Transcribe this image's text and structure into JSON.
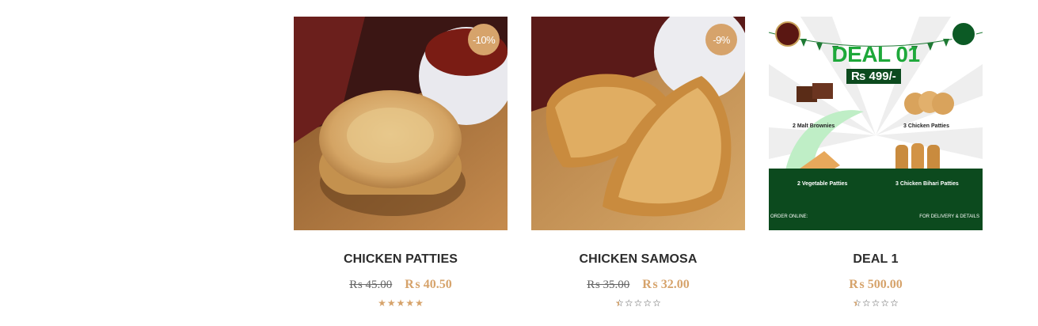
{
  "products": [
    {
      "title": "CHICKEN PATTIES",
      "badge": "-10%",
      "old_price": "₨ 45.00",
      "new_price": "₨ 40.50",
      "rating": 5
    },
    {
      "title": "CHICKEN SAMOSA",
      "badge": "-9%",
      "old_price": "₨ 35.00",
      "new_price": "₨ 32.00",
      "rating": 0.5
    },
    {
      "title": "DEAL 1",
      "badge": "",
      "old_price": "",
      "new_price": "₨ 500.00",
      "rating": 0.5,
      "banner": {
        "heading": "DEAL 01",
        "price": "₨ 499/-",
        "items": [
          "2 Malt Brownies",
          "3 Chicken Patties",
          "2 Vegetable Patties",
          "3 Chicken Bihari Patties"
        ],
        "order_online": "ORDER ONLINE:",
        "delivery": "FOR DELIVERY & DETAILS"
      }
    }
  ],
  "colors": {
    "accent": "#d6a36b",
    "title": "#2c2c2c",
    "deal_green": "#0c4a1e"
  }
}
